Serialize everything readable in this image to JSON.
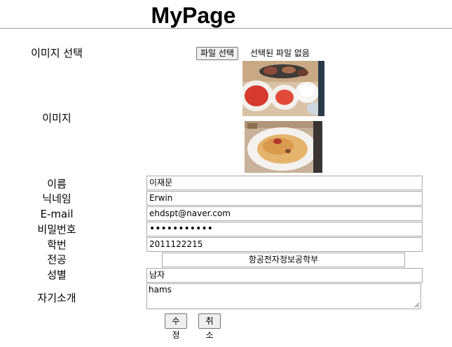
{
  "page": {
    "title": "MyPage"
  },
  "form": {
    "image_select_label": "이미지 선택",
    "file_button_label": "파일 선택",
    "file_status": "선택된 파일 없음",
    "image_label": "이미지",
    "name_label": "이름",
    "name_value": "이재문",
    "nickname_label": "닉네임",
    "nickname_value": "Erwin",
    "email_label": "E-mail",
    "email_value": "ehdspt@naver.com",
    "password_label": "비밀번호",
    "password_value": "•••••••••••",
    "student_id_label": "학번",
    "student_id_value": "2011122215",
    "major_label": "전공",
    "major_value": "항공전자정보공학부",
    "gender_label": "성별",
    "gender_value": "남자",
    "intro_label": "자기소개",
    "intro_value": "hams",
    "submit_label": "수정",
    "cancel_label": "취소"
  }
}
